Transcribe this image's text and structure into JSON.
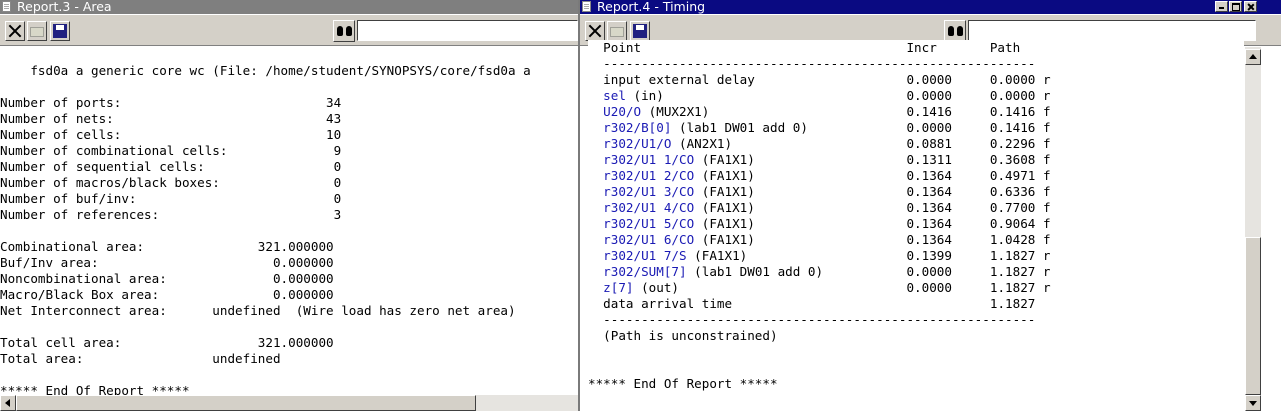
{
  "area_window": {
    "title": "Report.3 - Area",
    "report_lines": [
      "",
      "    fsd0a a generic core wc (File: /home/student/SYNOPSYS/core/fsd0a a",
      "",
      "Number of ports:                           34",
      "Number of nets:                            43",
      "Number of cells:                           10",
      "Number of combinational cells:              9",
      "Number of sequential cells:                 0",
      "Number of macros/black boxes:               0",
      "Number of buf/inv:                          0",
      "Number of references:                       3",
      "",
      "Combinational area:               321.000000",
      "Buf/Inv area:                       0.000000",
      "Noncombinational area:              0.000000",
      "Macro/Black Box area:               0.000000",
      "Net Interconnect area:      undefined  (Wire load has zero net area)",
      "",
      "Total cell area:                  321.000000",
      "Total area:                 undefined",
      "",
      "***** End Of Report *****"
    ]
  },
  "timing_window": {
    "title": "Report.4 - Timing",
    "header": "  Point                                   Incr       Path",
    "separator": "  ---------------------------------------------------------",
    "rows": [
      {
        "point": "input external delay",
        "suffix": "",
        "incr": "0.0000",
        "path": "0.0000 r"
      },
      {
        "point": "sel",
        "suffix": " (in)",
        "incr": "0.0000",
        "path": "0.0000 r"
      },
      {
        "point": "U20/O",
        "suffix": " (MUX2X1)",
        "incr": "0.1416",
        "path": "0.1416 f"
      },
      {
        "point": "r302/B[0]",
        "suffix": " (lab1 DW01 add 0)",
        "incr": "0.0000",
        "path": "0.1416 f"
      },
      {
        "point": "r302/U1/O",
        "suffix": " (AN2X1)",
        "incr": "0.0881",
        "path": "0.2296 f"
      },
      {
        "point": "r302/U1 1/CO",
        "suffix": " (FA1X1)",
        "incr": "0.1311",
        "path": "0.3608 f"
      },
      {
        "point": "r302/U1 2/CO",
        "suffix": " (FA1X1)",
        "incr": "0.1364",
        "path": "0.4971 f"
      },
      {
        "point": "r302/U1 3/CO",
        "suffix": " (FA1X1)",
        "incr": "0.1364",
        "path": "0.6336 f"
      },
      {
        "point": "r302/U1 4/CO",
        "suffix": " (FA1X1)",
        "incr": "0.1364",
        "path": "0.7700 f"
      },
      {
        "point": "r302/U1 5/CO",
        "suffix": " (FA1X1)",
        "incr": "0.1364",
        "path": "0.9064 f"
      },
      {
        "point": "r302/U1 6/CO",
        "suffix": " (FA1X1)",
        "incr": "0.1364",
        "path": "1.0428 f"
      },
      {
        "point": "r302/U1 7/S",
        "suffix": " (FA1X1)",
        "incr": "0.1399",
        "path": "1.1827 r"
      },
      {
        "point": "r302/SUM[7]",
        "suffix": " (lab1 DW01 add 0)",
        "incr": "0.0000",
        "path": "1.1827 r"
      },
      {
        "point": "z[7]",
        "suffix": " (out)",
        "incr": "0.0000",
        "path": "1.1827 r"
      },
      {
        "point": "data arrival time",
        "suffix": "",
        "incr": "",
        "path": "1.1827"
      }
    ],
    "unconstrained": "  (Path is unconstrained)",
    "end": "***** End Of Report *****"
  }
}
